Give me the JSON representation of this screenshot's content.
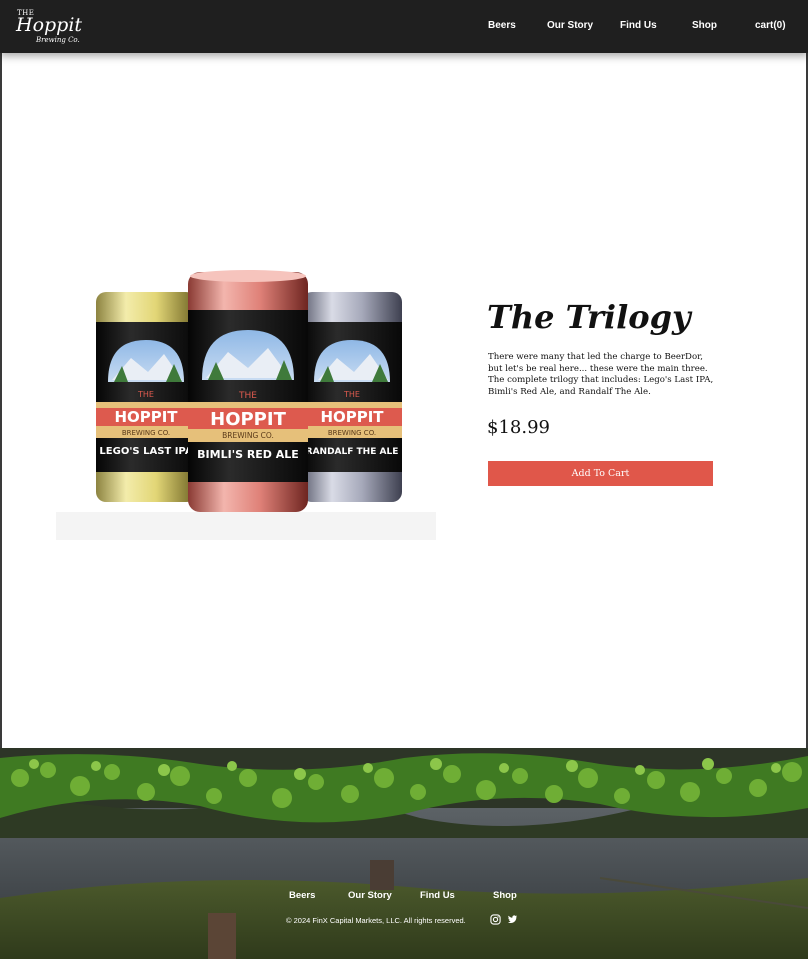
{
  "header": {
    "logo": {
      "the": "THE",
      "name": "Hoppit",
      "sub": "Brewing Co."
    },
    "nav": {
      "beers": "Beers",
      "our_story": "Our Story",
      "find_us": "Find Us",
      "shop": "Shop",
      "cart": "cart(0)"
    }
  },
  "product": {
    "title": "The Trilogy",
    "description": "There were many that led the charge to BeerDor, but let's be real here... these were the main three. The complete trilogy that includes: Lego's Last IPA, Bimli's Red Ale, and Randalf The Ale.",
    "price": "$18.99",
    "add_to_cart_label": "Add To Cart",
    "cans": [
      {
        "brand_top": "THE",
        "brand": "HOPPIT",
        "brand_sub": "BREWING CO.",
        "name": "LEGO'S LAST IPA",
        "color": "#e7df8f"
      },
      {
        "brand_top": "THE",
        "brand": "HOPPIT",
        "brand_sub": "BREWING CO.",
        "name": "BIMLI'S RED ALE",
        "color": "#e78f86"
      },
      {
        "brand_top": "THE",
        "brand": "HOPPIT",
        "brand_sub": "BREWING CO.",
        "name": "RANDALF THE ALE",
        "color": "#a9acbd"
      }
    ]
  },
  "footer": {
    "nav": {
      "beers": "Beers",
      "our_story": "Our Story",
      "find_us": "Find Us",
      "shop": "Shop"
    },
    "copyright": "© 2024 FinX Capital Markets, LLC. All rights reserved.",
    "social": [
      "instagram-icon",
      "twitter-icon"
    ]
  },
  "colors": {
    "header_bg": "#1f1f1f",
    "accent_button": "#e0574a",
    "ivy_green": "#5a9a2e"
  }
}
